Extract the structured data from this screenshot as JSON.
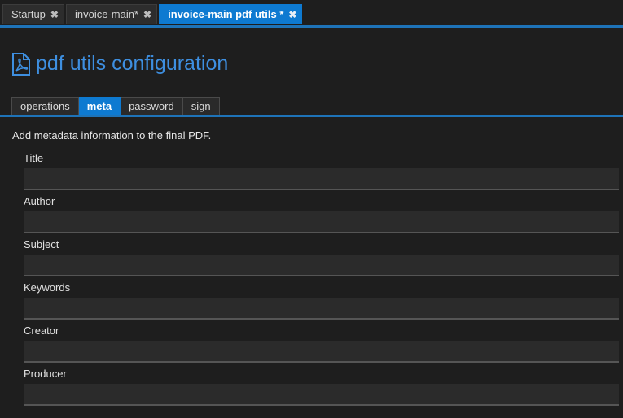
{
  "editor_tabs": [
    {
      "label": "Startup",
      "close": "✖",
      "active": false
    },
    {
      "label": "invoice-main*",
      "close": "✖",
      "active": false
    },
    {
      "label": "invoice-main pdf utils *",
      "close": "✖",
      "active": true
    }
  ],
  "header": {
    "icon": "pdf-file-icon",
    "title": "pdf utils configuration"
  },
  "config_tabs": [
    {
      "label": "operations",
      "active": false
    },
    {
      "label": "meta",
      "active": true
    },
    {
      "label": "password",
      "active": false
    },
    {
      "label": "sign",
      "active": false
    }
  ],
  "description": "Add metadata information to the final PDF.",
  "fields": [
    {
      "label": "Title",
      "value": ""
    },
    {
      "label": "Author",
      "value": ""
    },
    {
      "label": "Subject",
      "value": ""
    },
    {
      "label": "Keywords",
      "value": ""
    },
    {
      "label": "Creator",
      "value": ""
    },
    {
      "label": "Producer",
      "value": ""
    }
  ],
  "colors": {
    "accent": "#0e7ad1",
    "title": "#3e8fe0",
    "background": "#1e1e1e"
  }
}
